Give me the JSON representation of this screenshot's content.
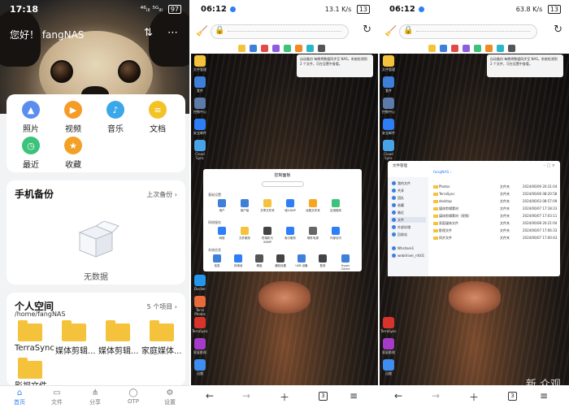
{
  "left_app": {
    "status": {
      "time": "17:18",
      "signal": "⁴⁶ᵢₗₗ ⁵ᴳᵢₗₗ",
      "battery": "97"
    },
    "greeting": "您好！ fangNAS",
    "quick": [
      {
        "label": "照片",
        "color": "#5b8def",
        "glyph": "▲"
      },
      {
        "label": "视频",
        "color": "#f59b26",
        "glyph": "▶"
      },
      {
        "label": "音乐",
        "color": "#3aa7e8",
        "glyph": "♪"
      },
      {
        "label": "文档",
        "color": "#f3c227",
        "glyph": "≡"
      },
      {
        "label": "最近",
        "color": "#3cc279",
        "glyph": "◷"
      },
      {
        "label": "收藏",
        "color": "#f3a126",
        "glyph": "★"
      }
    ],
    "backup": {
      "title": "手机备份",
      "right": "上次备份",
      "empty": "无数据"
    },
    "space": {
      "title": "个人空间",
      "path": "/home/fangNAS",
      "count": "5 个项目",
      "folders": [
        "TerraSync",
        "媒体剪辑...",
        "媒体剪辑...",
        "家庭媒体...",
        "影视文件..."
      ]
    },
    "nav": [
      "首页",
      "文件",
      "分享",
      "OTP",
      "设置"
    ]
  },
  "browser_a": {
    "status": {
      "time": "06:12",
      "net": "13.1 K/s",
      "battery": "13"
    },
    "notice": "自动备份 每晚将数据同步至 NAS，系统检测到 2 个文件，可在设置中查看。",
    "panel": {
      "title": "控制面板",
      "sections": [
        {
          "title": "基础设置",
          "items": [
            "用户",
            "用户组",
            "共享文件夹",
            "域/LDAP",
            "远程文件夹",
            "应用程序"
          ]
        },
        {
          "title": "网络服务",
          "items": [
            "网络",
            "文件服务",
            "终端机与 SNMP",
            "索引服务",
            "硬件电源",
            "外部访问"
          ]
        },
        {
          "title": "系统信息",
          "items": [
            "信息",
            "存储池",
            "硬盘",
            "通知设置",
            "USB 设备",
            "登录",
            "Hyper Cache"
          ]
        }
      ]
    },
    "desktop_icons": [
      "文件管理",
      "套件",
      "控制中心",
      "安全邮件",
      "Cloud Sync",
      "Docker",
      "Terra Photos",
      "TerraSync",
      "家庭影视",
      "迅雷"
    ],
    "tabs": "3"
  },
  "browser_b": {
    "status": {
      "time": "06:12",
      "net": "63.8 K/s",
      "battery": "13"
    },
    "fm": {
      "title": "文件管理",
      "breadcrumb": "fangNAS ›",
      "sidebar": [
        "我的文件",
        "共享",
        "团队",
        "收藏",
        "最近",
        "文件",
        "外部存储",
        "回收站",
        "Nfsshare1",
        "webdriver_nfs01"
      ],
      "rows": [
        {
          "name": "Photos",
          "type": "文件夹",
          "date": "2024/06/09 20:31:04"
        },
        {
          "name": "TerraSync",
          "type": "文件夹",
          "date": "2024/06/06 08:20:58"
        },
        {
          "name": "desktop",
          "type": "文件夹",
          "date": "2024/06/03 08:57:09"
        },
        {
          "name": "媒体剪辑素材",
          "type": "文件夹",
          "date": "2024/06/07 17:18:23"
        },
        {
          "name": "媒体剪辑素材（视频）",
          "type": "文件夹",
          "date": "2024/06/07 17:03:11"
        },
        {
          "name": "家庭媒体文件",
          "type": "文件夹",
          "date": "2024/06/08 20:21:04"
        },
        {
          "name": "影视文件",
          "type": "文件夹",
          "date": "2024/06/07 17:06:33"
        },
        {
          "name": "同步文件",
          "type": "文件夹",
          "date": "2024/06/07 17:00:43"
        }
      ]
    },
    "tabs": "3",
    "watermark": "新 众观"
  }
}
